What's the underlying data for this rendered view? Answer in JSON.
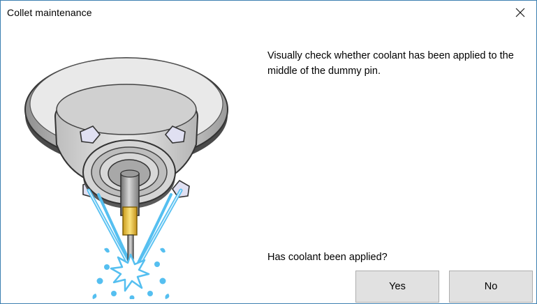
{
  "window": {
    "title": "Collet maintenance"
  },
  "content": {
    "message": "Visually check whether coolant has been applied to the middle of the dummy pin.",
    "question": "Has coolant been applied?"
  },
  "buttons": {
    "yes_label": "Yes",
    "no_label": "No"
  },
  "illustration": {
    "subject": "spindle-collet-coolant-spray",
    "colors": {
      "body": "#d9d9d9",
      "outline": "#3a3a3a",
      "coolant": "#55bff0",
      "nozzle": "#d8d8f0",
      "collet_brass": "#f2c94c"
    }
  },
  "icons": {
    "close": "close-icon"
  }
}
